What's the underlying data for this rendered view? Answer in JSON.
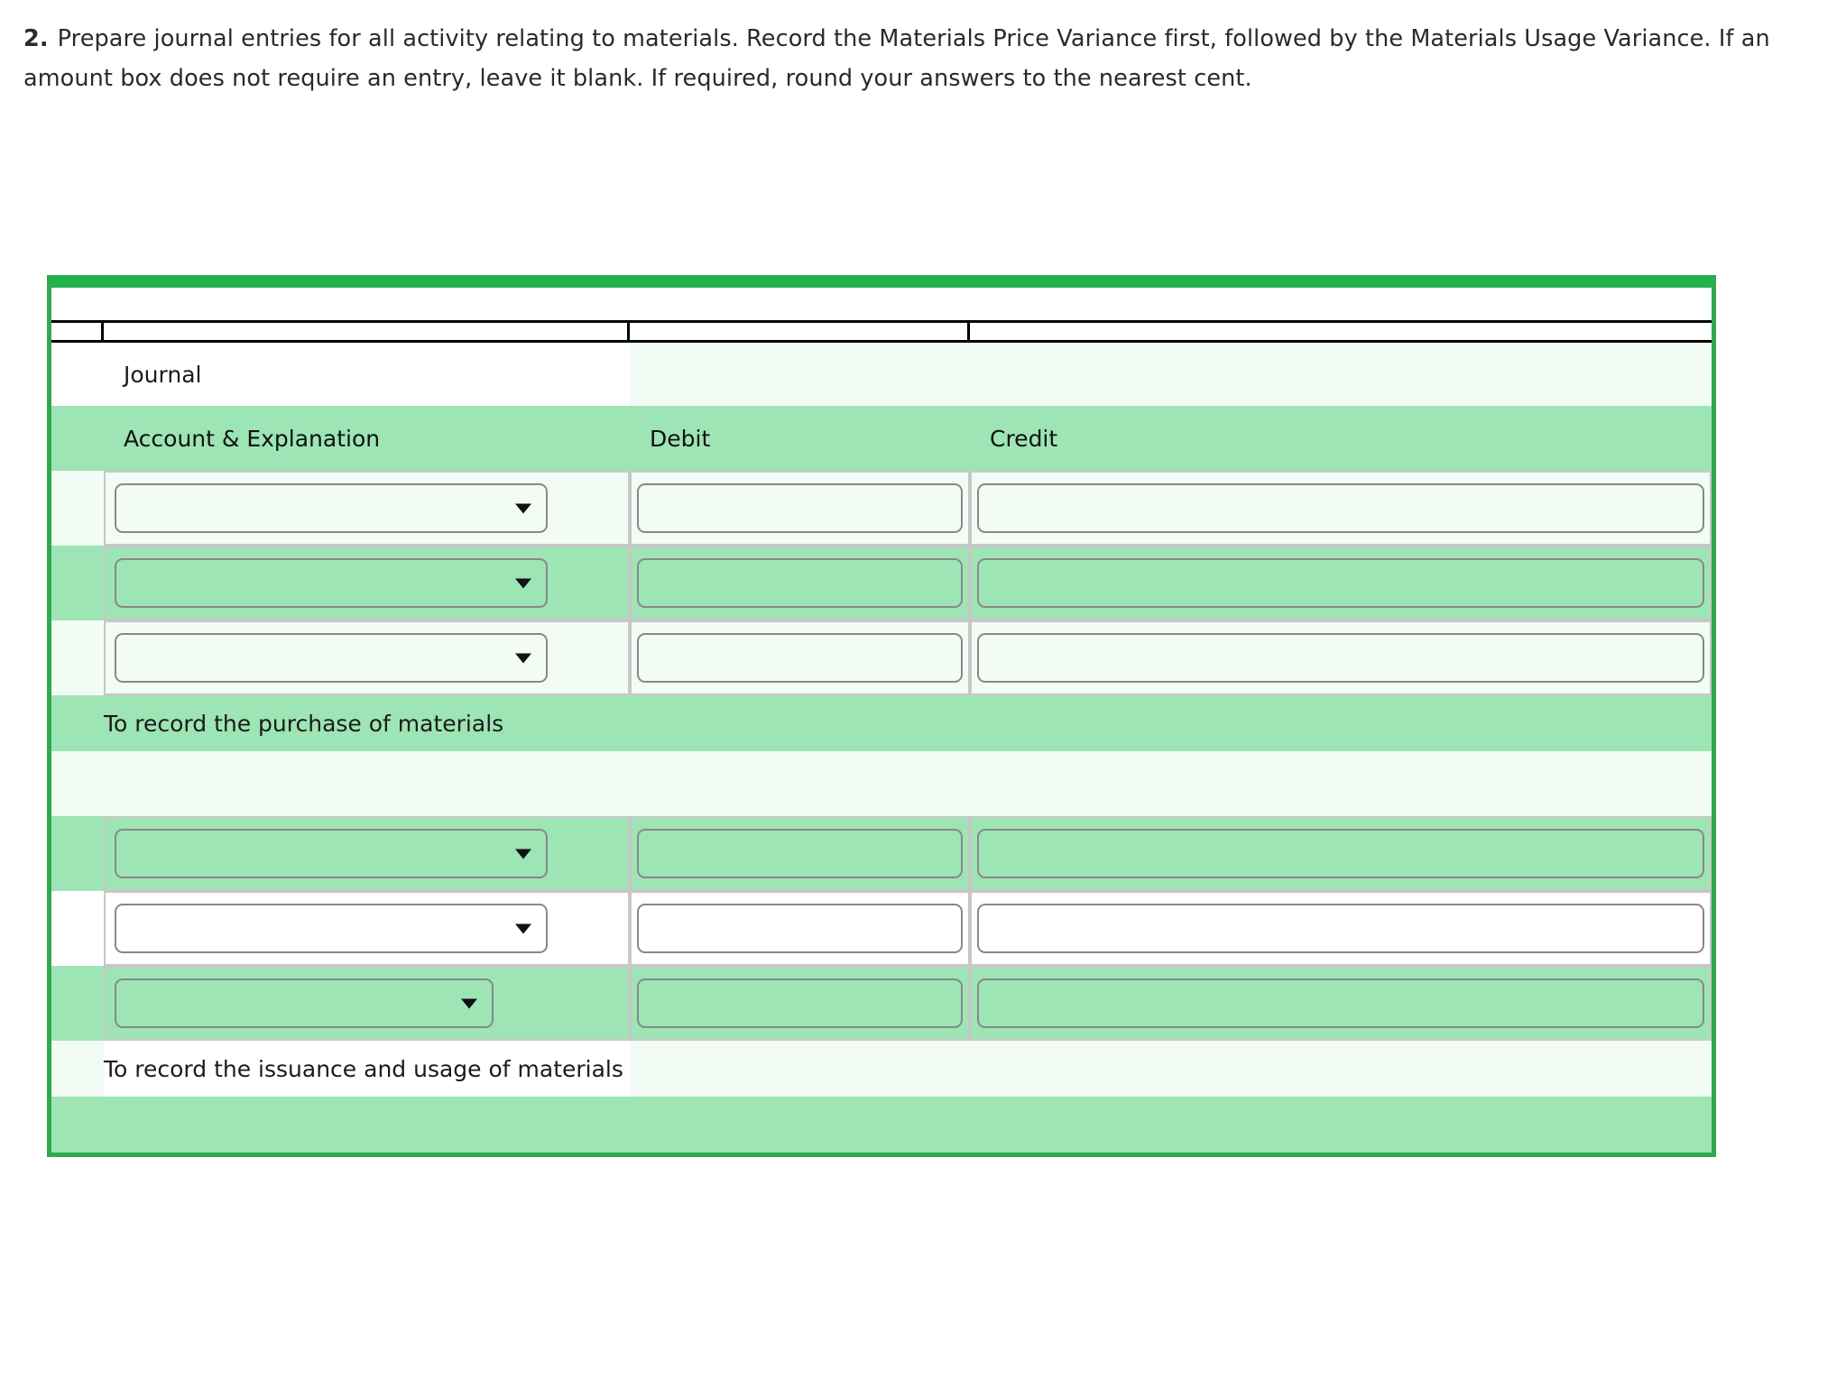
{
  "question": {
    "number": "2.",
    "text": "Prepare journal entries for all activity relating to materials. Record the Materials Price Variance first, followed by the Materials Usage Variance. If an amount box does not require an entry, leave it blank. If required, round your answers to the nearest cent."
  },
  "journal": {
    "title": "Journal",
    "columns": {
      "account": "Account & Explanation",
      "debit": "Debit",
      "credit": "Credit"
    },
    "explanations": {
      "purchase": "To record the purchase of materials",
      "issuance": "To record the issuance and usage of materials"
    },
    "entries": [
      {
        "account": "",
        "debit": "",
        "credit": ""
      },
      {
        "account": "",
        "debit": "",
        "credit": ""
      },
      {
        "account": "",
        "debit": "",
        "credit": ""
      },
      {
        "account": "",
        "debit": "",
        "credit": ""
      },
      {
        "account": "",
        "debit": "",
        "credit": ""
      },
      {
        "account": "",
        "debit": "",
        "credit": ""
      }
    ]
  },
  "colors": {
    "accent_green": "#22b24c",
    "border_green": "#2fa84f",
    "row_mid_green": "#9de5b4",
    "row_pale_green": "#f2fbf4",
    "control_border": "#888888",
    "cell_border": "#c7c7c7"
  }
}
